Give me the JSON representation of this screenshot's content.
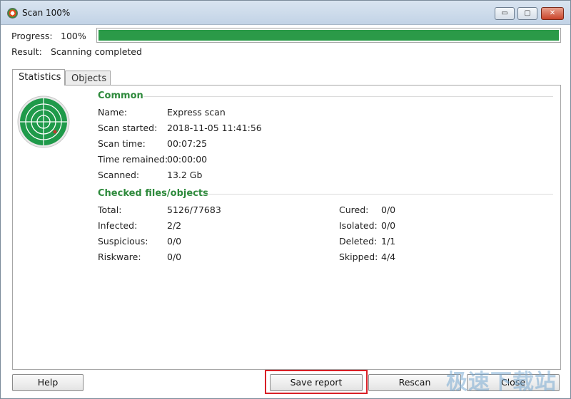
{
  "window": {
    "title": "Scan 100%",
    "controls": {
      "minimize": "▭",
      "maximize": "▢",
      "close": "✕"
    }
  },
  "progress": {
    "label": "Progress:",
    "value": "100%",
    "fraction": 1.0,
    "color": "#2b9a48"
  },
  "result": {
    "label": "Result:",
    "value": "Scanning completed"
  },
  "tabs": [
    {
      "label": "Statistics",
      "active": true
    },
    {
      "label": "Objects",
      "active": false
    }
  ],
  "common": {
    "title": "Common",
    "rows": [
      {
        "label": "Name:",
        "value": "Express scan"
      },
      {
        "label": "Scan started:",
        "value": "2018-11-05 11:41:56"
      },
      {
        "label": "Scan time:",
        "value": "00:07:25"
      },
      {
        "label": "Time remained:",
        "value": "00:00:00"
      },
      {
        "label": "Scanned:",
        "value": "13.2 Gb"
      }
    ]
  },
  "checked": {
    "title": "Checked files/objects",
    "left": [
      {
        "label": "Total:",
        "value": "5126/77683"
      },
      {
        "label": "Infected:",
        "value": "2/2"
      },
      {
        "label": "Suspicious:",
        "value": "0/0"
      },
      {
        "label": "Riskware:",
        "value": "0/0"
      }
    ],
    "right": [
      {
        "label": "Cured:",
        "value": "0/0"
      },
      {
        "label": "Isolated:",
        "value": "0/0"
      },
      {
        "label": "Deleted:",
        "value": "1/1"
      },
      {
        "label": "Skipped:",
        "value": "4/4"
      }
    ]
  },
  "icons": {
    "radar": "radar-icon",
    "accent": "#2e8a3c"
  },
  "buttons": {
    "help": "Help",
    "save_report": "Save report",
    "rescan": "Rescan",
    "close": "Close"
  },
  "watermark": "极速下载站"
}
